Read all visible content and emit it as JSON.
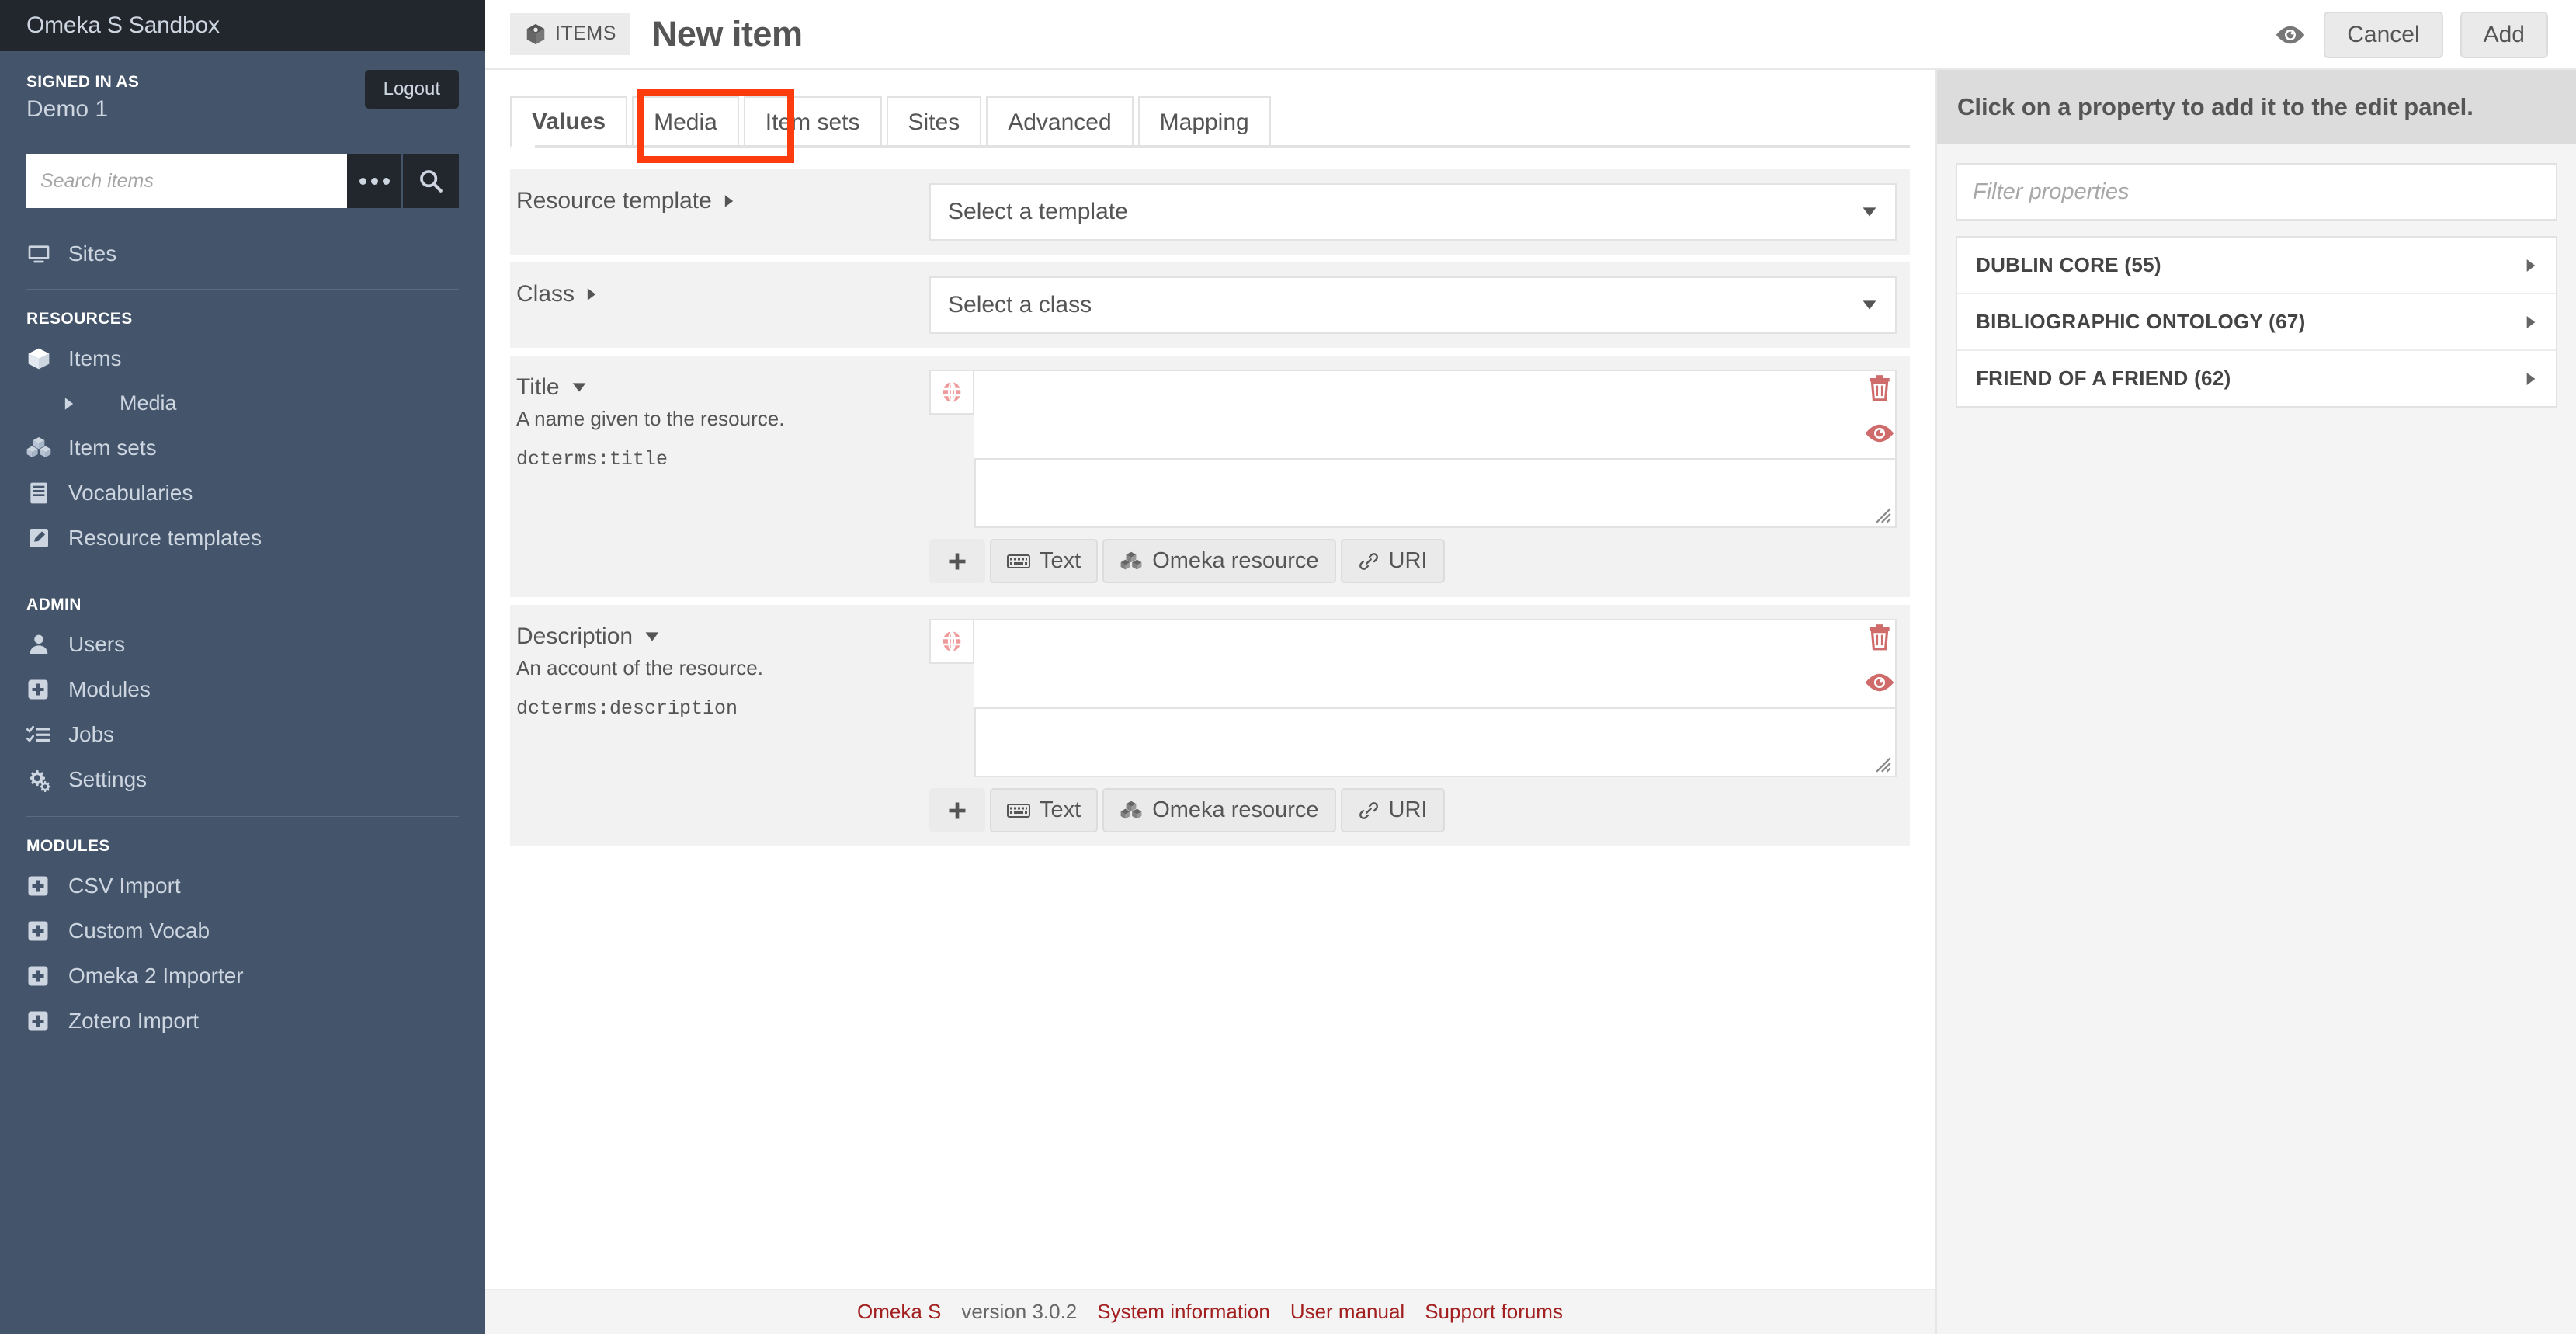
{
  "sidebar": {
    "site_title": "Omeka S Sandbox",
    "signed_in_label": "SIGNED IN AS",
    "user_name": "Demo 1",
    "logout_label": "Logout",
    "search_placeholder": "Search items",
    "search_value": "",
    "advanced_search_icon": "ellipsis-icon",
    "search_icon": "search-icon",
    "top_items": [
      {
        "label": "Sites",
        "icon": "monitor-icon"
      }
    ],
    "sections": [
      {
        "heading": "RESOURCES",
        "items": [
          {
            "label": "Items",
            "icon": "cube-icon",
            "sub": false
          },
          {
            "label": "Media",
            "icon": "caret-right-icon",
            "sub": true
          },
          {
            "label": "Item sets",
            "icon": "cubes-icon",
            "sub": false
          },
          {
            "label": "Vocabularies",
            "icon": "book-icon",
            "sub": false
          },
          {
            "label": "Resource templates",
            "icon": "pencil-square-icon",
            "sub": false
          }
        ]
      },
      {
        "heading": "ADMIN",
        "items": [
          {
            "label": "Users",
            "icon": "user-icon",
            "sub": false
          },
          {
            "label": "Modules",
            "icon": "plus-square-icon",
            "sub": false
          },
          {
            "label": "Jobs",
            "icon": "tasks-icon",
            "sub": false
          },
          {
            "label": "Settings",
            "icon": "gears-icon",
            "sub": false
          }
        ]
      },
      {
        "heading": "MODULES",
        "items": [
          {
            "label": "CSV Import",
            "icon": "plus-square-icon",
            "sub": false
          },
          {
            "label": "Custom Vocab",
            "icon": "plus-square-icon",
            "sub": false
          },
          {
            "label": "Omeka 2 Importer",
            "icon": "plus-square-icon",
            "sub": false
          },
          {
            "label": "Zotero Import",
            "icon": "plus-square-icon",
            "sub": false
          }
        ]
      }
    ]
  },
  "topbar": {
    "breadcrumb_label": "ITEMS",
    "breadcrumb_icon": "cube-icon",
    "page_title": "New item",
    "preview_icon": "eye-icon",
    "cancel_label": "Cancel",
    "add_label": "Add"
  },
  "tabs": [
    {
      "label": "Values",
      "active": true
    },
    {
      "label": "Media",
      "active": false,
      "highlighted": true
    },
    {
      "label": "Item sets",
      "active": false
    },
    {
      "label": "Sites",
      "active": false
    },
    {
      "label": "Advanced",
      "active": false
    },
    {
      "label": "Mapping",
      "active": false
    }
  ],
  "highlight_color": "#fc3c0c",
  "form": {
    "resource_template": {
      "label": "Resource template",
      "caret_icon": "caret-right-icon",
      "selected": "Select a template",
      "dropdown_icon": "caret-down-icon"
    },
    "resource_class": {
      "label": "Class",
      "caret_icon": "caret-right-icon",
      "selected": "Select a class",
      "dropdown_icon": "caret-down-icon"
    },
    "properties": [
      {
        "label": "Title",
        "caret_icon": "caret-down-icon",
        "description": "A name given to the resource.",
        "term": "dcterms:title",
        "value": "",
        "language_icon": "globe-icon",
        "delete_icon": "trash-icon",
        "visibility_icon": "eye-icon",
        "buttons": [
          {
            "label": "",
            "icon": "plus-icon"
          },
          {
            "label": "Text",
            "icon": "keyboard-icon"
          },
          {
            "label": "Omeka resource",
            "icon": "cubes-icon"
          },
          {
            "label": "URI",
            "icon": "link-icon"
          }
        ]
      },
      {
        "label": "Description",
        "caret_icon": "caret-down-icon",
        "description": "An account of the resource.",
        "term": "dcterms:description",
        "value": "",
        "language_icon": "globe-icon",
        "delete_icon": "trash-icon",
        "visibility_icon": "eye-icon",
        "buttons": [
          {
            "label": "",
            "icon": "plus-icon"
          },
          {
            "label": "Text",
            "icon": "keyboard-icon"
          },
          {
            "label": "Omeka resource",
            "icon": "cubes-icon"
          },
          {
            "label": "URI",
            "icon": "link-icon"
          }
        ]
      }
    ]
  },
  "right_panel": {
    "heading": "Click on a property to add it to the edit panel.",
    "filter_placeholder": "Filter properties",
    "filter_value": "",
    "vocabularies": [
      {
        "name": "DUBLIN CORE (55)",
        "caret_icon": "caret-right-icon"
      },
      {
        "name": "BIBLIOGRAPHIC ONTOLOGY (67)",
        "caret_icon": "caret-right-icon"
      },
      {
        "name": "FRIEND OF A FRIEND (62)",
        "caret_icon": "caret-right-icon"
      }
    ]
  },
  "footer": {
    "brand": "Omeka S",
    "version": "version 3.0.2",
    "links": [
      "System information",
      "User manual",
      "Support forums"
    ]
  }
}
